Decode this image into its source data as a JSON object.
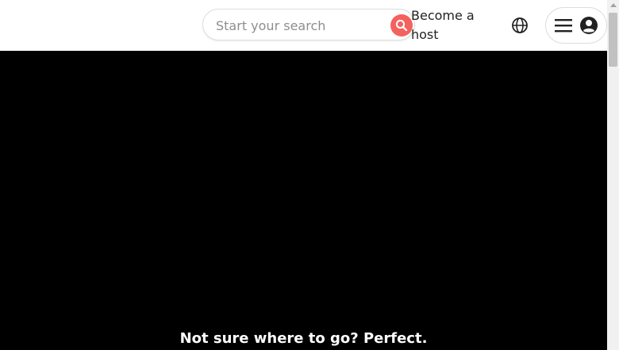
{
  "header": {
    "search": {
      "placeholder": "Start your search",
      "value": "",
      "button_icon": "search-icon",
      "button_color": "#f4625e"
    },
    "host_link_label": "Become a host",
    "globe_icon": "globe-icon",
    "menu": {
      "hamburger_icon": "hamburger-icon",
      "avatar_icon": "user-avatar-icon"
    }
  },
  "hero": {
    "background": "#000000",
    "tagline": "Not sure where to go? Perfect."
  }
}
